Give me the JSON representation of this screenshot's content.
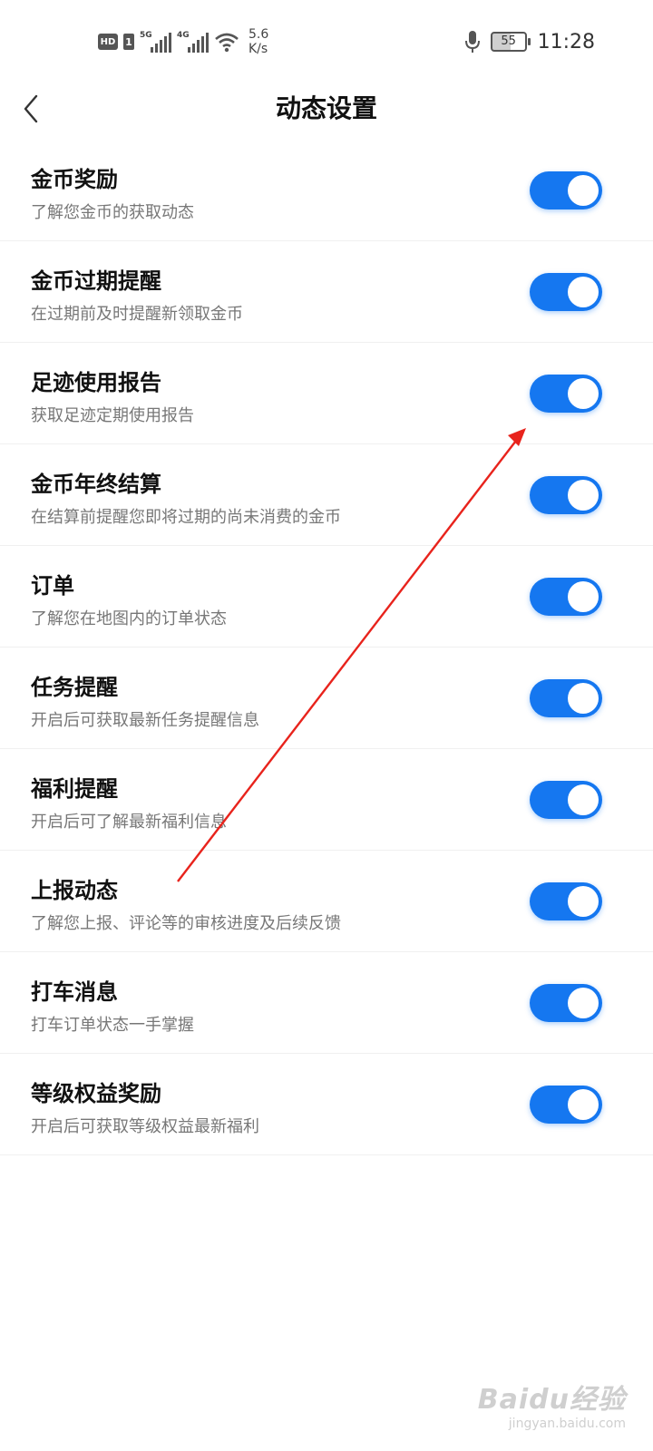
{
  "status_bar": {
    "hd": "HD",
    "sim": "1",
    "net1": "5G",
    "net2": "4G",
    "speed_value": "5.6",
    "speed_unit": "K/s",
    "battery": "55",
    "time": "11:28"
  },
  "header": {
    "title": "动态设置"
  },
  "settings": [
    {
      "title": "金币奖励",
      "desc": "了解您金币的获取动态",
      "on": true
    },
    {
      "title": "金币过期提醒",
      "desc": "在过期前及时提醒新领取金币",
      "on": true
    },
    {
      "title": "足迹使用报告",
      "desc": "获取足迹定期使用报告",
      "on": true
    },
    {
      "title": "金币年终结算",
      "desc": "在结算前提醒您即将过期的尚未消费的金币",
      "on": true
    },
    {
      "title": "订单",
      "desc": "了解您在地图内的订单状态",
      "on": true
    },
    {
      "title": "任务提醒",
      "desc": "开启后可获取最新任务提醒信息",
      "on": true
    },
    {
      "title": "福利提醒",
      "desc": "开启后可了解最新福利信息",
      "on": true
    },
    {
      "title": "上报动态",
      "desc": "了解您上报、评论等的审核进度及后续反馈",
      "on": true
    },
    {
      "title": "打车消息",
      "desc": "打车订单状态一手掌握",
      "on": true
    },
    {
      "title": "等级权益奖励",
      "desc": "开启后可获取等级权益最新福利",
      "on": true
    }
  ],
  "watermark": {
    "main": "Baidu经验",
    "sub": "jingyan.baidu.com"
  },
  "colors": {
    "toggle_on": "#1577f0",
    "arrow": "#e8231c"
  }
}
